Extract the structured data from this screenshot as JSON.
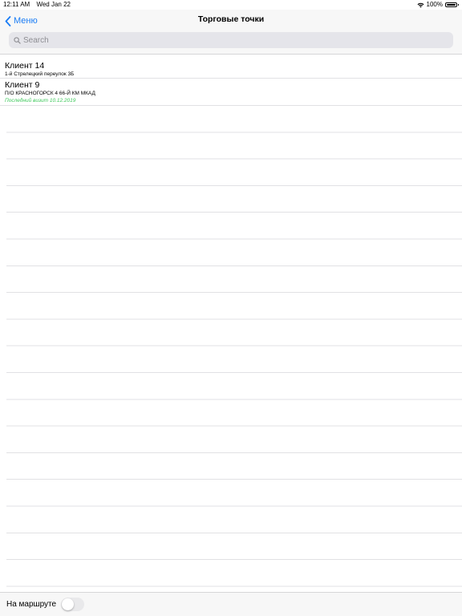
{
  "status_bar": {
    "time": "12:11 AM",
    "date": "Wed Jan 22",
    "battery": "100%"
  },
  "nav": {
    "back_label": "Меню",
    "title": "Торговые точки"
  },
  "search": {
    "placeholder": "Search",
    "value": ""
  },
  "clients": [
    {
      "name": "Клиент 14",
      "address": "1-й Стрелецкий переулок 3Б"
    },
    {
      "name": "Клиент 9",
      "address": "П/О КРАСНОГОРСК 4 66-Й КМ МКАД",
      "last_visit": "Последний визит 10.12.2019"
    }
  ],
  "bottom_bar": {
    "route_label": "На маршруте",
    "route_toggle_on": false
  },
  "colors": {
    "accent": "#1a7cf5",
    "visit_green": "#3cc85a"
  }
}
